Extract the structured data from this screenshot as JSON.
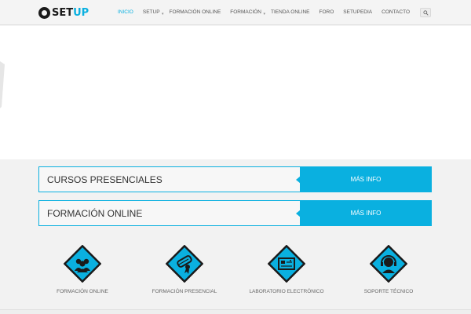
{
  "header": {
    "logo_text": "SET",
    "logo_text_accent": "UP",
    "nav": [
      {
        "label": "INICIO",
        "active": true,
        "dropdown": false
      },
      {
        "label": "SETUP",
        "active": false,
        "dropdown": true
      },
      {
        "label": "FORMACIÓN ONLINE",
        "active": false,
        "dropdown": false
      },
      {
        "label": "FORMACIÓN",
        "active": false,
        "dropdown": true
      },
      {
        "label": "TIENDA ONLINE",
        "active": false,
        "dropdown": false
      },
      {
        "label": "FORO",
        "active": false,
        "dropdown": false
      },
      {
        "label": "SETUPEDIA",
        "active": false,
        "dropdown": false
      },
      {
        "label": "CONTACTO",
        "active": false,
        "dropdown": false
      }
    ],
    "search_icon": "search-icon"
  },
  "bands": [
    {
      "label": "CURSOS PRESENCIALES",
      "button": "MÁS INFO"
    },
    {
      "label": "FORMACIÓN ONLINE",
      "button": "MÁS INFO"
    }
  ],
  "features": [
    {
      "label": "FORMACIÓN ONLINE",
      "icon": "users-icon"
    },
    {
      "label": "FORMACIÓN PRESENCIAL",
      "icon": "diploma-icon"
    },
    {
      "label": "LABORATORIO ELECTRÓNICO",
      "icon": "circuit-board-icon"
    },
    {
      "label": "SOPORTE TÉCNICO",
      "icon": "headset-icon"
    }
  ],
  "colors": {
    "accent": "#0ab0e0",
    "text": "#333333",
    "background": "#f2f2f2"
  }
}
